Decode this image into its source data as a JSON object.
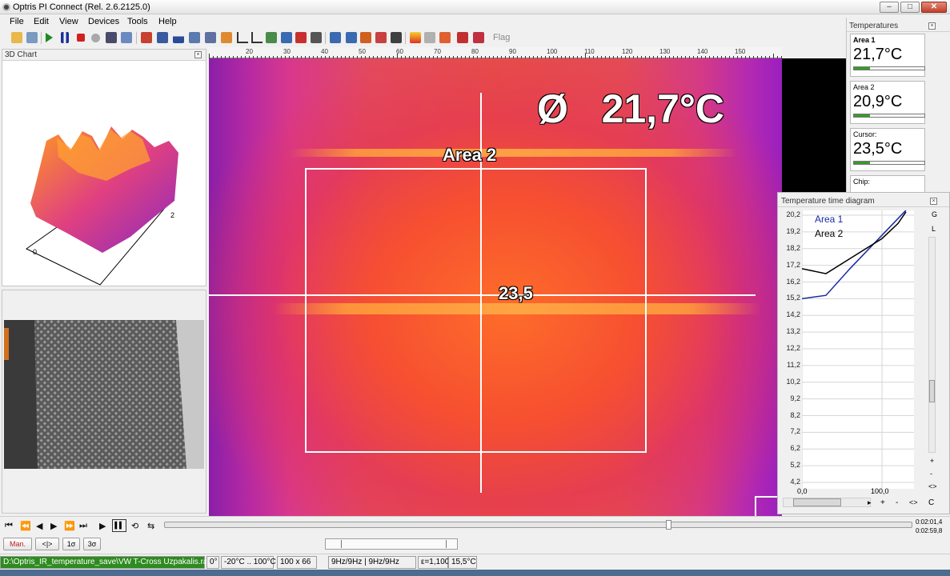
{
  "window": {
    "title": "Optris PI Connect (Rel. 2.6.2125.0)",
    "buttons": [
      "–",
      "□",
      "✕"
    ]
  },
  "menu": [
    "File",
    "Edit",
    "View",
    "Devices",
    "Tools",
    "Help"
  ],
  "toolbar": {
    "flag_label": "Flag"
  },
  "chart3d": {
    "title": "3D Chart",
    "axis_labels": [
      "0",
      "2"
    ]
  },
  "ruler": {
    "ticks": [
      "20",
      "30",
      "40",
      "50",
      "60",
      "70",
      "80",
      "90",
      "100",
      "110",
      "120",
      "130",
      "140",
      "150"
    ]
  },
  "thermal": {
    "average": "Ø   21,7°C",
    "area_label": "Area 2",
    "cursor_value": "23,5"
  },
  "temperatures": {
    "title": "Temperatures",
    "items": [
      {
        "label": "Area 1",
        "value": "21,7°C"
      },
      {
        "label": "Area 2",
        "value": "20,9°C"
      },
      {
        "label": "Cursor:",
        "value": "23,5°C"
      },
      {
        "label": "Chip:",
        "value": ""
      }
    ]
  },
  "time_diagram": {
    "title": "Temperature time diagram",
    "side_labels": [
      "G",
      "L",
      "+",
      "-",
      "<>",
      "C"
    ],
    "bottom_buttons": [
      "+",
      "-",
      "<>",
      "C"
    ]
  },
  "chart_data": {
    "type": "line",
    "y_ticks": [
      "20,2",
      "19,2",
      "18,2",
      "17,2",
      "16,2",
      "15,2",
      "14,2",
      "13,2",
      "12,2",
      "11,2",
      "10,2",
      "9,2",
      "8,2",
      "7,2",
      "6,2",
      "5,2",
      "4,2"
    ],
    "x_ticks": [
      "0,0",
      "100,0"
    ],
    "ylim": [
      4.2,
      20.2
    ],
    "xlim": [
      0,
      140
    ],
    "series": [
      {
        "name": "Area 1",
        "color": "#1a2aa0",
        "x": [
          0,
          30,
          60,
          100,
          120,
          130
        ],
        "y": [
          15.2,
          15.4,
          17.0,
          19.0,
          20.0,
          20.5
        ]
      },
      {
        "name": "Area 2",
        "color": "#000000",
        "x": [
          0,
          30,
          60,
          100,
          120,
          130
        ],
        "y": [
          17.0,
          16.7,
          17.6,
          18.8,
          19.7,
          20.4
        ]
      }
    ],
    "grid": true,
    "legend": "top-left"
  },
  "transport": {
    "play_label": "▶",
    "pause_label": "▌▌",
    "time_current": "0:02:01,4",
    "time_total": "0:02:59,8"
  },
  "modebar": {
    "buttons": [
      "Man.",
      "<|>",
      "1σ",
      "3σ"
    ]
  },
  "status": {
    "path": "D:\\Optris_IR_temperature_save\\VW T-Cross Uzpakalis.ravi",
    "angle": "0°",
    "range": "-20°C .. 100°C",
    "resolution": "100 x 66",
    "framerate": "9Hz/9Hz | 9Hz/9Hz",
    "emissivity": "ε=1,100",
    "ambient": "15,5°C"
  },
  "colors": {
    "accent_green": "#2e8b1f",
    "area1_line": "#1a2aa0"
  }
}
